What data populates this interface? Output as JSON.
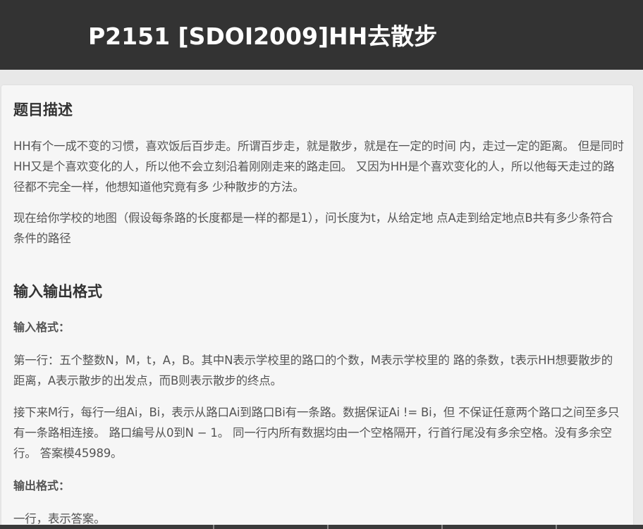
{
  "header": {
    "title": "P2151 [SDOI2009]HH去散步"
  },
  "sections": {
    "description": {
      "heading": "题目描述",
      "paragraphs": [
        "HH有个一成不变的习惯，喜欢饭后百步走。所谓百步走，就是散步，就是在一定的时间 内，走过一定的距离。 但是同时HH又是个喜欢变化的人，所以他不会立刻沿着刚刚走来的路走回。 又因为HH是个喜欢变化的人，所以他每天走过的路径都不完全一样，他想知道他究竟有多 少种散步的方法。",
        "现在给你学校的地图（假设每条路的长度都是一样的都是1），问长度为t，从给定地 点A走到给定地点B共有多少条符合条件的路径"
      ]
    },
    "io_format": {
      "heading": "输入输出格式",
      "input_heading": "输入格式：",
      "input_paragraphs": [
        "第一行：五个整数N，M，t，A，B。其中N表示学校里的路口的个数，M表示学校里的 路的条数，t表示HH想要散步的距离，A表示散步的出发点，而B则表示散步的终点。",
        "接下来M行，每行一组Ai，Bi，表示从路口Ai到路口Bi有一条路。数据保证Ai != Bi，但 不保证任意两个路口之间至多只有一条路相连接。 路口编号从0到N − 1。 同一行内所有数据均由一个空格隔开，行首行尾没有多余空格。没有多余空行。 答案模45989。"
      ],
      "output_heading": "输出格式：",
      "output_paragraphs": [
        "一行，表示答案。"
      ]
    }
  },
  "colors": {
    "header_bg": "#333333",
    "page_bg": "#e8e8e8",
    "card_bg": "#f6f6f6",
    "heading_text": "#333333",
    "body_text": "#555555"
  }
}
